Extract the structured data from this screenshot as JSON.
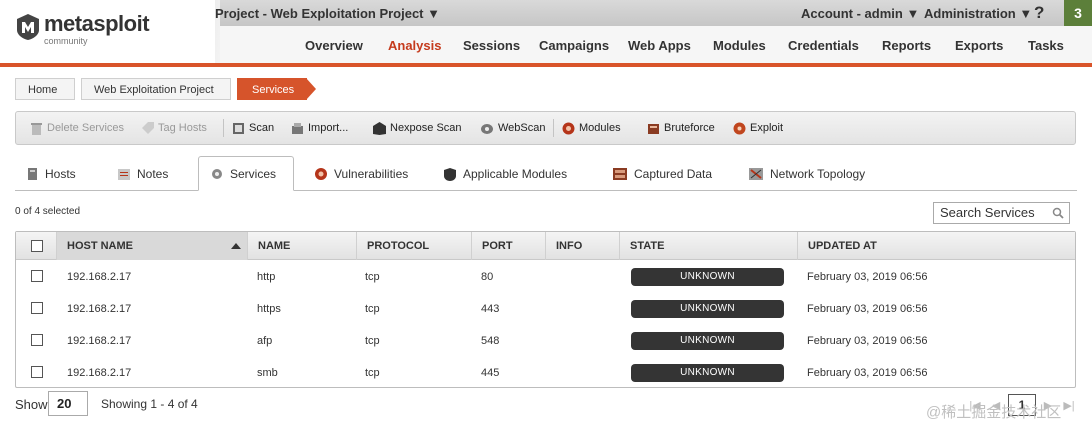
{
  "app": {
    "logo_name": "metasploit",
    "logo_edition": "community",
    "project_menu": "Project - Web Exploitation Project ▼",
    "account_menu": "Account - admin ▼",
    "admin_menu": "Administration ▼",
    "help": "?",
    "notification_count": "3"
  },
  "main_nav": [
    "Overview",
    "Analysis",
    "Sessions",
    "Campaigns",
    "Web Apps",
    "Modules",
    "Credentials",
    "Reports",
    "Exports",
    "Tasks"
  ],
  "breadcrumb": [
    "Home",
    "Web Exploitation Project",
    "Services"
  ],
  "toolbar": {
    "delete_services": "Delete Services",
    "tag_hosts": "Tag Hosts",
    "scan": "Scan",
    "import": "Import...",
    "nexpose_scan": "Nexpose Scan",
    "webscan": "WebScan",
    "modules": "Modules",
    "bruteforce": "Bruteforce",
    "exploit": "Exploit"
  },
  "tabs": [
    "Hosts",
    "Notes",
    "Services",
    "Vulnerabilities",
    "Applicable Modules",
    "Captured Data",
    "Network Topology"
  ],
  "selected_count": "0 of 4 selected",
  "search": {
    "placeholder": "Search Services"
  },
  "table": {
    "headers": [
      "HOST NAME",
      "NAME",
      "PROTOCOL",
      "PORT",
      "INFO",
      "STATE",
      "UPDATED AT"
    ],
    "rows": [
      {
        "host": "192.168.2.17",
        "name": "http",
        "protocol": "tcp",
        "port": "80",
        "info": "",
        "state": "UNKNOWN",
        "updated": "February 03, 2019 06:56"
      },
      {
        "host": "192.168.2.17",
        "name": "https",
        "protocol": "tcp",
        "port": "443",
        "info": "",
        "state": "UNKNOWN",
        "updated": "February 03, 2019 06:56"
      },
      {
        "host": "192.168.2.17",
        "name": "afp",
        "protocol": "tcp",
        "port": "548",
        "info": "",
        "state": "UNKNOWN",
        "updated": "February 03, 2019 06:56"
      },
      {
        "host": "192.168.2.17",
        "name": "smb",
        "protocol": "tcp",
        "port": "445",
        "info": "",
        "state": "UNKNOWN",
        "updated": "February 03, 2019 06:56"
      }
    ]
  },
  "footer": {
    "show_label": "Show",
    "page_size": "20",
    "showing": "Showing 1 - 4 of 4",
    "current_page": "1",
    "watermark": "@稀土掘金技术社区"
  },
  "colors": {
    "accent": "#d9542a",
    "active_nav": "#c53a1c",
    "state_pill": "#343434",
    "badge": "#5c7f3a"
  }
}
